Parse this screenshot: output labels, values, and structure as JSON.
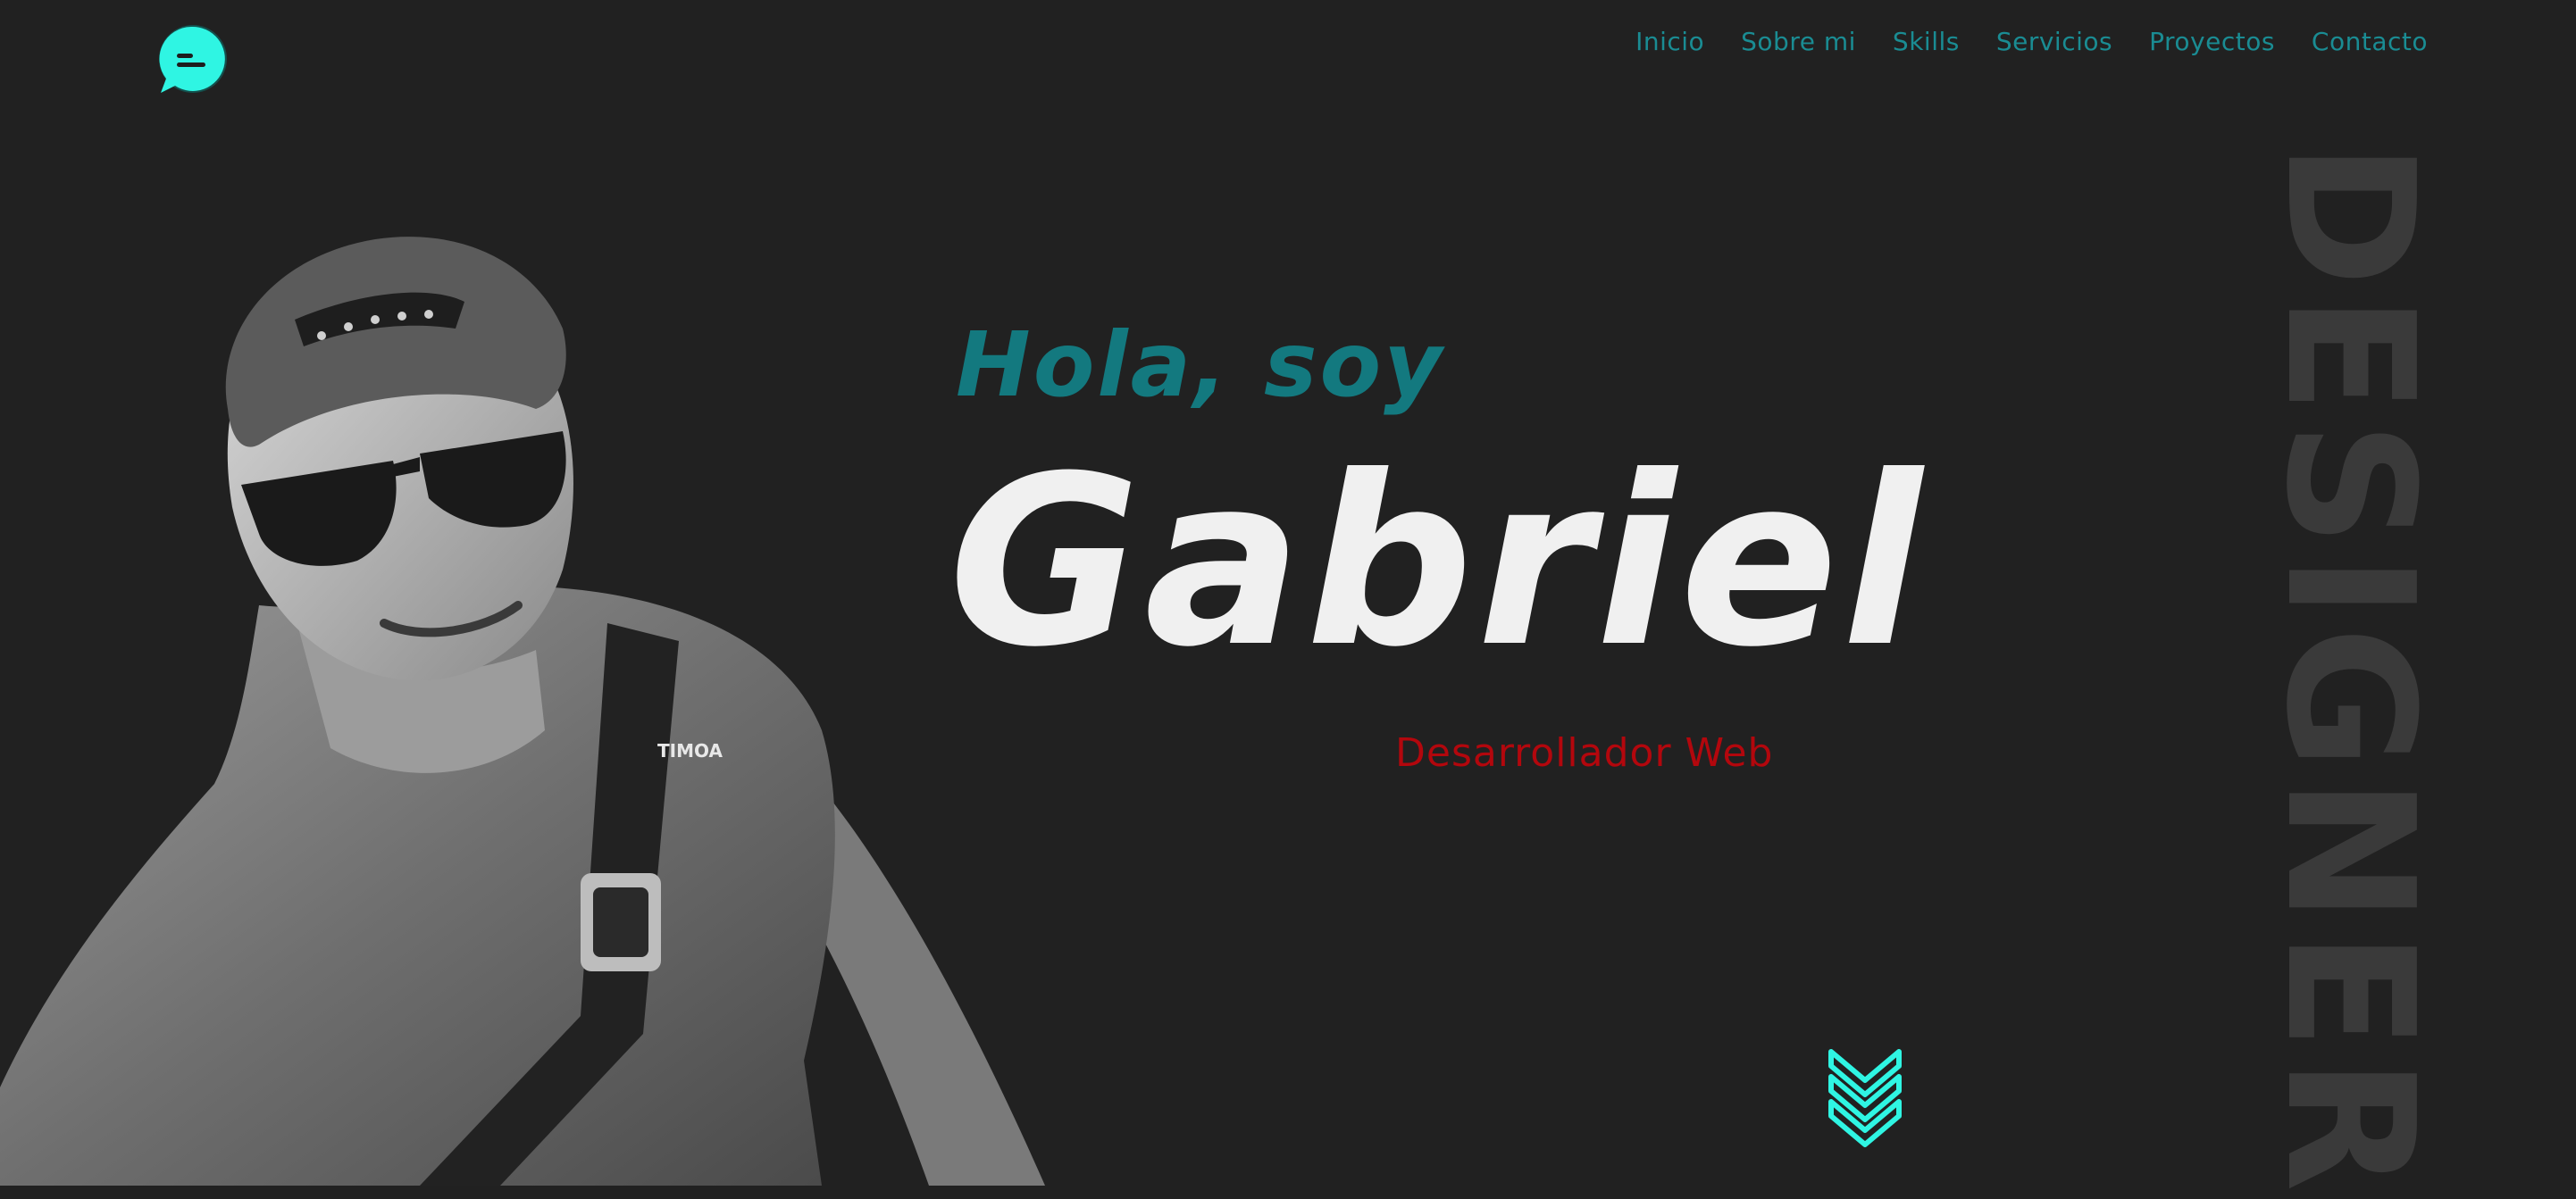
{
  "header": {
    "logo_icon": "chat-bubble-icon",
    "nav": [
      {
        "label": "Inicio"
      },
      {
        "label": "Sobre mi"
      },
      {
        "label": "Skills"
      },
      {
        "label": "Servicios"
      },
      {
        "label": "Proyectos"
      },
      {
        "label": "Contacto"
      }
    ]
  },
  "hero": {
    "greeting": "Hola, soy",
    "name": "Gabriel",
    "role": "Desarrollador Web",
    "vertical_word": "DESIGNER",
    "photo_shirt_text": "TIMOA",
    "scroll_icon": "chevrons-down-icon"
  },
  "colors": {
    "background": "#212121",
    "accent": "#2ff5e3",
    "nav": "#1a8c93",
    "greeting": "#13797f",
    "name": "#f0f0f0",
    "role": "#b3070d",
    "vertical_word": "#3a3a3a"
  }
}
